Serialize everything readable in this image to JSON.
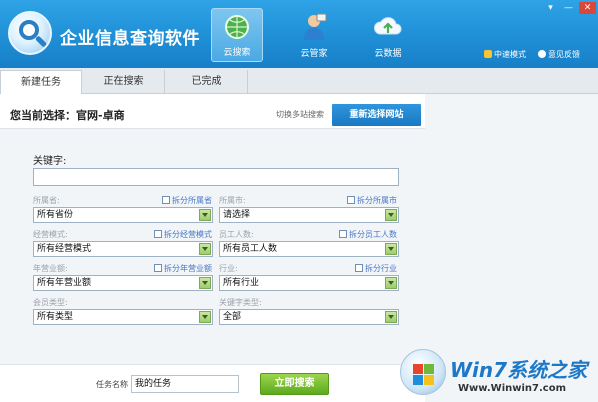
{
  "header": {
    "title": "企业信息查询软件",
    "nav": [
      {
        "label": "云搜索",
        "icon": "globe-search-icon",
        "active": true
      },
      {
        "label": "云管家",
        "icon": "manager-person-icon",
        "active": false
      },
      {
        "label": "云数据",
        "icon": "cloud-data-icon",
        "active": false
      }
    ],
    "window_controls": {
      "menu": "▾",
      "minimize": "—",
      "close": "✕"
    },
    "links": {
      "speed_mode": "中速模式",
      "feedback": "意见反馈"
    }
  },
  "tabs": [
    {
      "label": "新建任务",
      "active": true
    },
    {
      "label": "正在搜索",
      "active": false
    },
    {
      "label": "已完成",
      "active": false
    }
  ],
  "selection": {
    "current_label": "您当前选择：官网-卓商",
    "switch_label": "切换多站搜索",
    "reselect_button": "重新选择网站"
  },
  "form": {
    "keyword_label": "关键字:",
    "keyword_value": "",
    "fields": {
      "province": {
        "label": "所属省:",
        "split": "拆分所属省",
        "value": "所有省份"
      },
      "city": {
        "label": "所属市:",
        "split": "拆分所属市",
        "value": "请选择"
      },
      "business_mode": {
        "label": "经营模式:",
        "split": "拆分经营模式",
        "value": "所有经营模式"
      },
      "employees": {
        "label": "员工人数:",
        "split": "拆分员工人数",
        "value": "所有员工人数"
      },
      "revenue": {
        "label": "年营业额:",
        "split": "拆分年营业额",
        "value": "所有年营业额"
      },
      "industry": {
        "label": "行业:",
        "split": "拆分行业",
        "value": "所有行业"
      },
      "member_type": {
        "label": "会员类型:",
        "value": "所有类型"
      },
      "keyword_type": {
        "label": "关键字类型:",
        "value": "全部"
      }
    }
  },
  "bottom": {
    "task_label": "任务名称",
    "task_value": "我的任务",
    "search_button": "立即搜索"
  },
  "watermark": {
    "brand": "Win7系统之家",
    "url": "Www.Winwin7.com"
  },
  "colors": {
    "header_blue": "#1f8fd6",
    "primary_button": "#1a79c3",
    "search_button_green": "#5ea91d"
  }
}
